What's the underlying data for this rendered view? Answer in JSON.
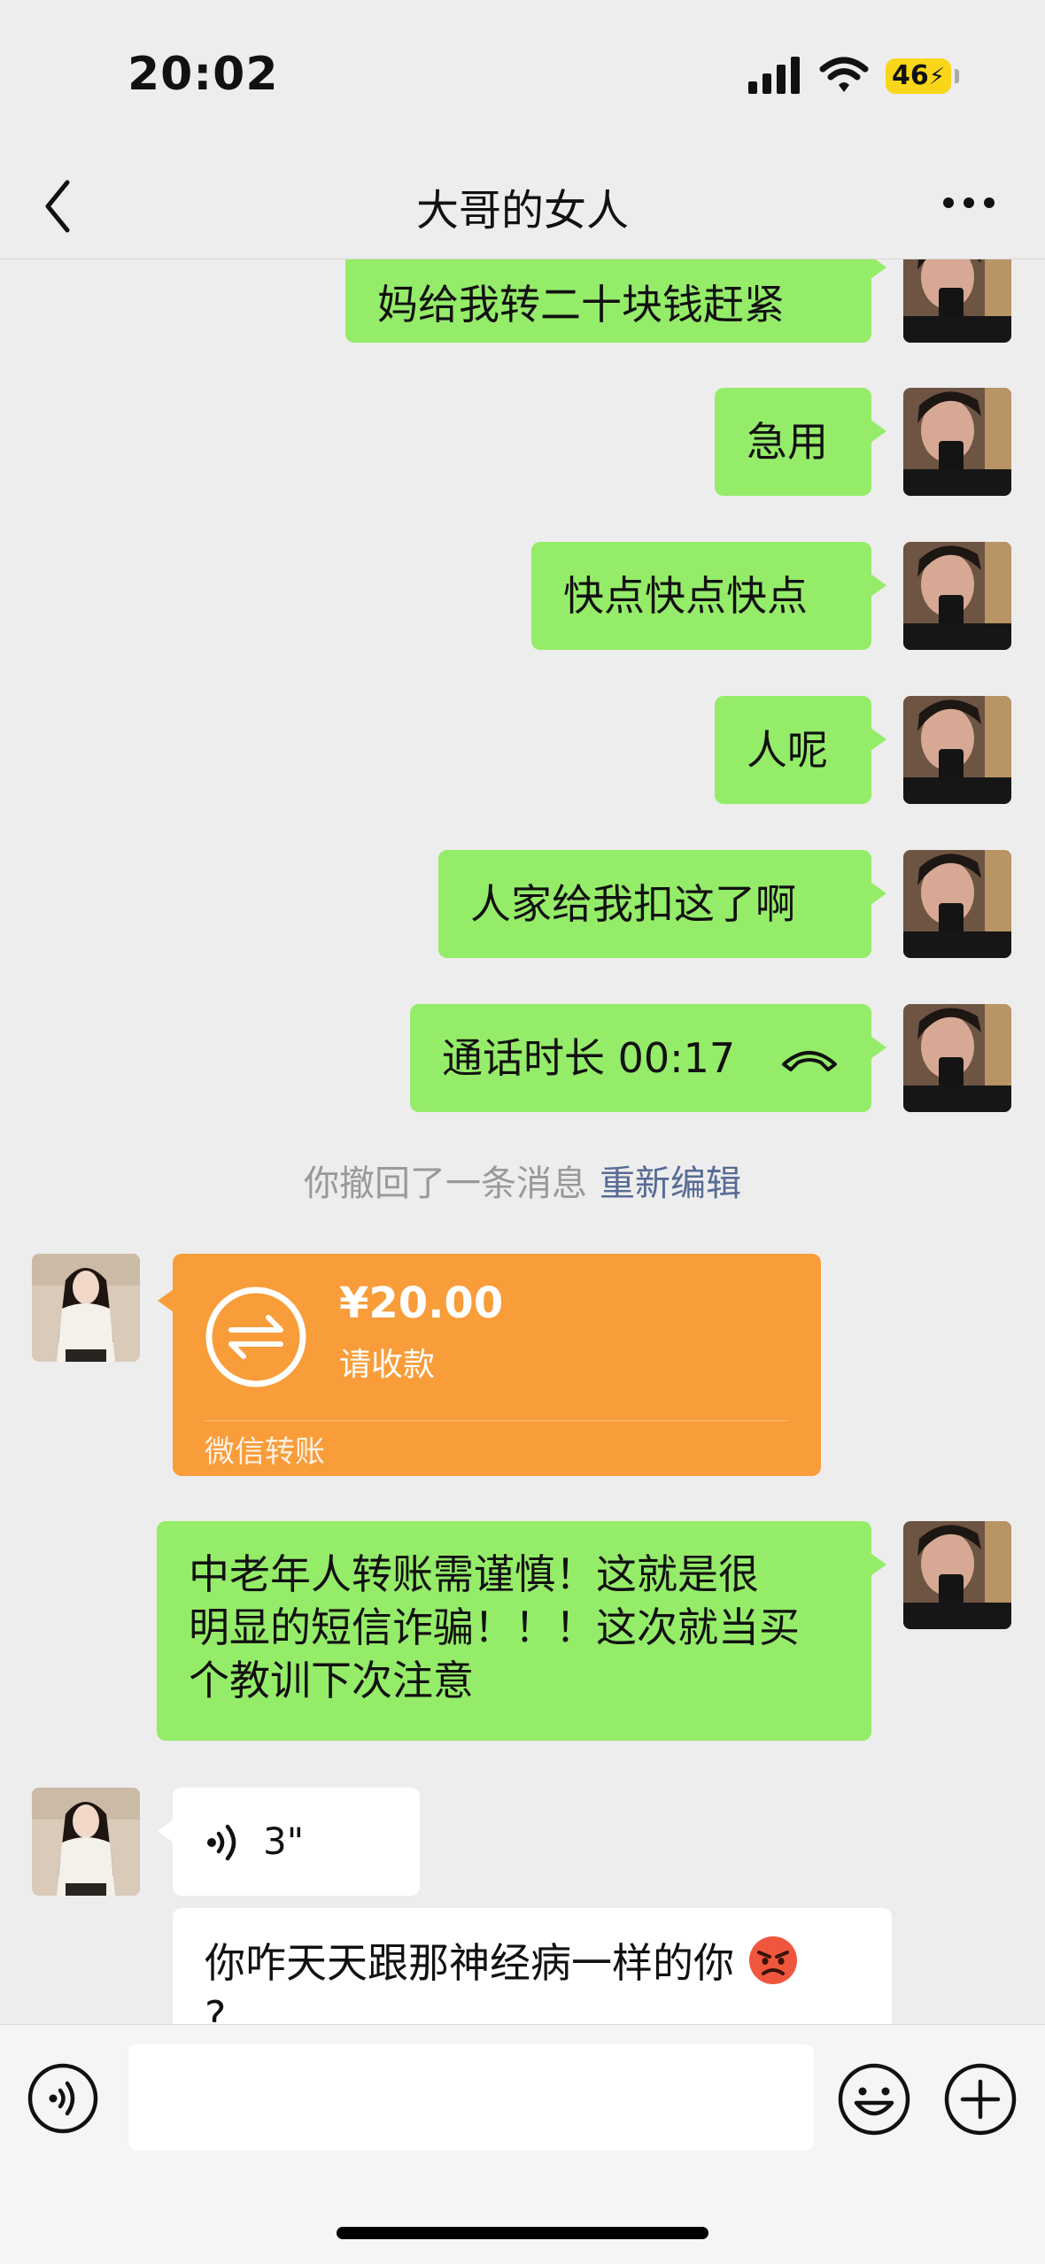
{
  "status_bar": {
    "time": "20:02",
    "battery": "46"
  },
  "nav": {
    "title": "大哥的女人"
  },
  "messages": {
    "m1": "妈给我转二十块钱赶紧",
    "m2": "急用",
    "m3": "快点快点快点",
    "m4": "人呢",
    "m5": "人家给我扣这了啊",
    "call": "通话时长 00:17",
    "recall_notice": "你撤回了一条消息",
    "recall_edit": "重新编辑",
    "transfer": {
      "amount": "¥20.00",
      "action": "请收款",
      "footer": "微信转账"
    },
    "m6_lines": [
      "中老年人转账需谨慎！这就是很",
      "明显的短信诈骗！！！这次就当买",
      "个教训下次注意"
    ],
    "voice_duration": "3\"",
    "m7_lines": [
      "你咋天天跟那神经病一样的你",
      "?"
    ]
  },
  "colors": {
    "outgoing": "#95ec69",
    "transfer": "#f89d3a",
    "link": "#576b95"
  },
  "icons": [
    "signal-icon",
    "wifi-icon",
    "back-icon",
    "more-icon",
    "phone-hangup-icon",
    "transfer-arrows-icon",
    "voice-wave-icon",
    "angry-face-emoji",
    "voice-input-icon",
    "emoji-icon",
    "plus-icon"
  ]
}
